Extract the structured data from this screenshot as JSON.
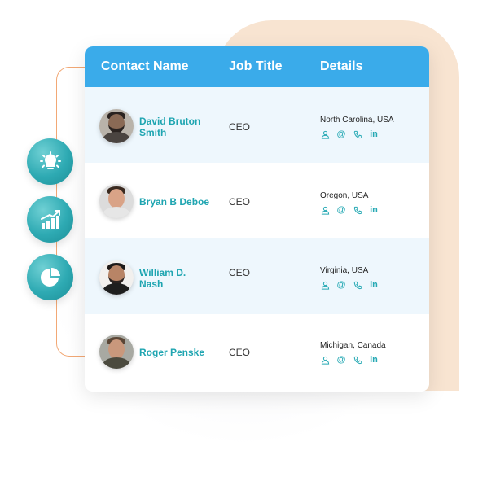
{
  "table": {
    "headers": {
      "contact_name": "Contact Name",
      "job_title": "Job Title",
      "details": "Details"
    },
    "rows": [
      {
        "name_line1": "David Bruton",
        "name_line2": "Smith",
        "job_title": "CEO",
        "location": "North Carolina, USA",
        "icons": [
          "user-icon",
          "email-icon",
          "phone-icon",
          "linkedin-icon"
        ]
      },
      {
        "name_line1": "Bryan B Deboe",
        "name_line2": "",
        "job_title": "CEO",
        "location": "Oregon, USA",
        "icons": [
          "user-icon",
          "email-icon",
          "phone-icon",
          "linkedin-icon"
        ]
      },
      {
        "name_line1": "William D.",
        "name_line2": "Nash",
        "job_title": "CEO",
        "location": "Virginia, USA",
        "icons": [
          "user-icon",
          "email-icon",
          "phone-icon",
          "linkedin-icon"
        ]
      },
      {
        "name_line1": "Roger Penske",
        "name_line2": "",
        "job_title": "CEO",
        "location": "Michigan, Canada",
        "icons": [
          "user-icon",
          "email-icon",
          "phone-icon",
          "linkedin-icon"
        ]
      }
    ]
  },
  "side_icons": [
    "lightbulb-icon",
    "growth-chart-icon",
    "pie-chart-icon"
  ],
  "glyphs": {
    "email": "@",
    "linkedin": "in"
  },
  "colors": {
    "header_bg": "#3aabea",
    "name_text": "#1fa5b1",
    "icon_teal": "#26a9b4",
    "peach_bg": "#f8e4d1",
    "bracket": "#f2a875",
    "row_alt": "#eef7fd"
  }
}
